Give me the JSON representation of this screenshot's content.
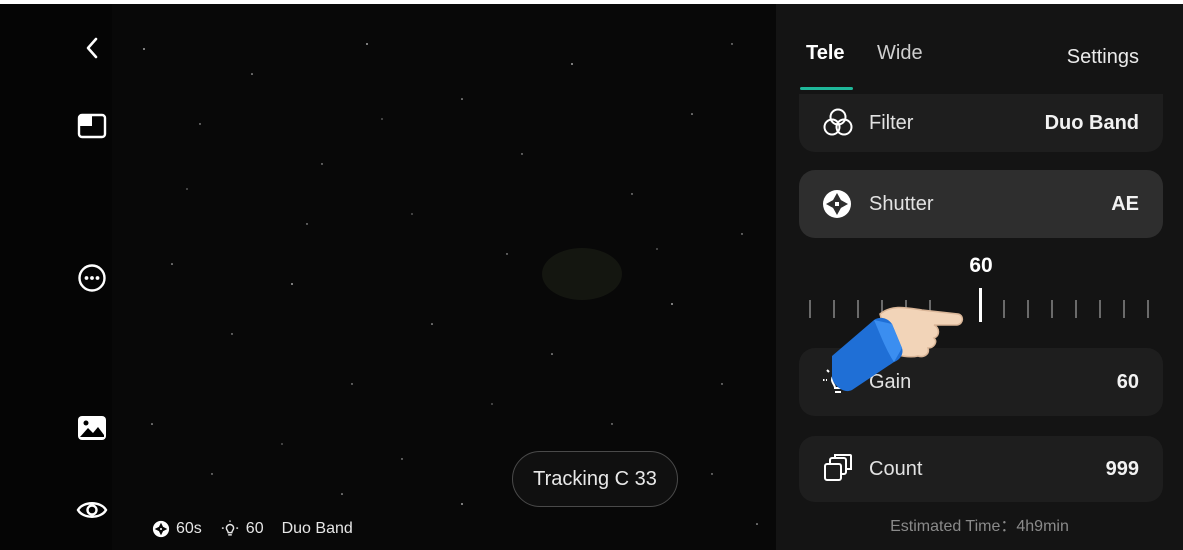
{
  "rail": {
    "icons": [
      "back-icon",
      "layout-icon",
      "more-icon",
      "gallery-icon",
      "eye-icon"
    ]
  },
  "viewfinder": {
    "status": {
      "shutter": "60s",
      "gain": "60",
      "filter": "Duo Band"
    },
    "tracking_label": "Tracking C 33"
  },
  "panel": {
    "tabs": [
      {
        "label": "Tele",
        "active": true
      },
      {
        "label": "Wide",
        "active": false
      }
    ],
    "settings_label": "Settings",
    "rows": {
      "filter": {
        "label": "Filter",
        "value": "Duo Band"
      },
      "shutter": {
        "label": "Shutter",
        "value": "AE"
      },
      "gain": {
        "label": "Gain",
        "value": "60"
      },
      "count": {
        "label": "Count",
        "value": "999"
      }
    },
    "dial": {
      "value": "60"
    },
    "estimated_time": "Estimated Time：4h9min"
  },
  "colors": {
    "accent": "#1fb89a",
    "panel_bg": "#141414",
    "row_bg": "#1e1e1e",
    "row_selected_bg": "#2e2e2e"
  }
}
